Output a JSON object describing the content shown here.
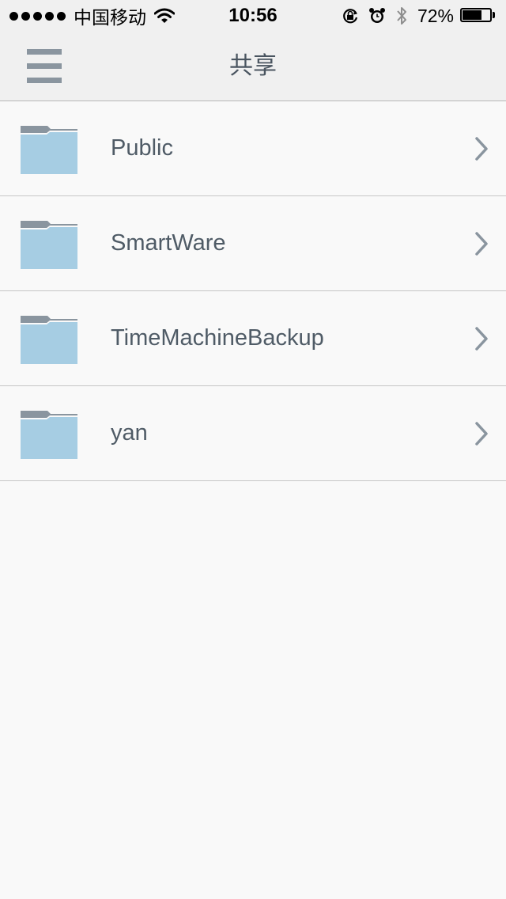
{
  "status_bar": {
    "carrier": "中国移动",
    "time": "10:56",
    "battery_percent": "72%",
    "battery_level": 0.72,
    "icons": [
      "signal-icon",
      "wifi-icon",
      "rotation-lock-icon",
      "alarm-icon",
      "bluetooth-icon",
      "battery-icon"
    ]
  },
  "nav": {
    "title": "共享",
    "menu_icon": "hamburger-menu-icon"
  },
  "folders": [
    {
      "name": "Public",
      "icon": "folder-icon"
    },
    {
      "name": "SmartWare",
      "icon": "folder-icon"
    },
    {
      "name": "TimeMachineBackup",
      "icon": "folder-icon"
    },
    {
      "name": "yan",
      "icon": "folder-icon"
    }
  ],
  "colors": {
    "background": "#f9f9f9",
    "bar_background": "#f0f0f0",
    "folder_body": "#a6cde3",
    "folder_tab": "#8a959f",
    "text": "#4f5b66",
    "chevron": "#8a959f"
  }
}
